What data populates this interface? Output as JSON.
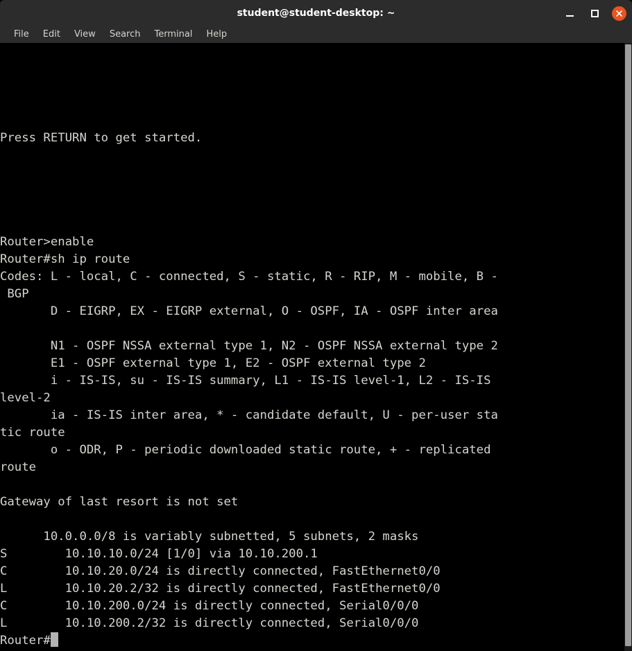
{
  "window": {
    "title": "student@student-desktop: ~",
    "titlebar_bg": "#2c2c2c",
    "terminal_bg": "#000000",
    "terminal_fg": "#d3d7cf",
    "close_button_bg": "#e95420",
    "controls": {
      "minimize_label": "Minimize",
      "maximize_label": "Maximize",
      "close_label": "Close"
    }
  },
  "menubar": {
    "items": [
      {
        "label": "File"
      },
      {
        "label": "Edit"
      },
      {
        "label": "View"
      },
      {
        "label": "Search"
      },
      {
        "label": "Terminal"
      },
      {
        "label": "Help"
      }
    ]
  },
  "terminal": {
    "prompt_user": "Router>",
    "prompt_priv": "Router#",
    "cursor_color": "#b3b3b3",
    "lines": [
      "",
      "",
      "",
      "",
      "",
      "Press RETURN to get started.",
      "",
      "",
      "",
      "",
      "",
      "Router>enable",
      "Router#sh ip route",
      "Codes: L - local, C - connected, S - static, R - RIP, M - mobile, B -",
      " BGP",
      "       D - EIGRP, EX - EIGRP external, O - OSPF, IA - OSPF inter area",
      "",
      "       N1 - OSPF NSSA external type 1, N2 - OSPF NSSA external type 2",
      "       E1 - OSPF external type 1, E2 - OSPF external type 2",
      "       i - IS-IS, su - IS-IS summary, L1 - IS-IS level-1, L2 - IS-IS",
      "level-2",
      "       ia - IS-IS inter area, * - candidate default, U - per-user sta",
      "tic route",
      "       o - ODR, P - periodic downloaded static route, + - replicated",
      "route",
      "",
      "Gateway of last resort is not set",
      "",
      "      10.0.0.0/8 is variably subnetted, 5 subnets, 2 masks",
      "S        10.10.10.0/24 [1/0] via 10.10.200.1",
      "C        10.10.20.0/24 is directly connected, FastEthernet0/0",
      "L        10.10.20.2/32 is directly connected, FastEthernet0/0",
      "C        10.10.200.0/24 is directly connected, Serial0/0/0",
      "L        10.10.200.2/32 is directly connected, Serial0/0/0"
    ],
    "last_line_prefix": "Router#"
  },
  "scrollbar": {
    "track_color": "#1a1a1a",
    "thumb_color": "#9d9d9d"
  }
}
